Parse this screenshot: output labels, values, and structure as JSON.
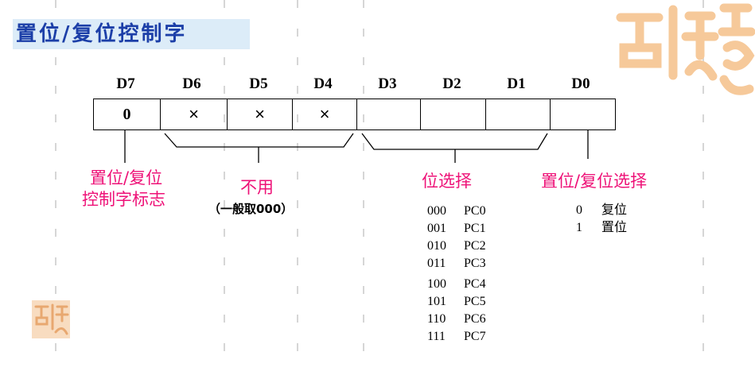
{
  "title": "置位/复位控制字",
  "bits": [
    {
      "label": "D7",
      "value": "0"
    },
    {
      "label": "D6",
      "value": "×"
    },
    {
      "label": "D5",
      "value": "×"
    },
    {
      "label": "D4",
      "value": "×"
    },
    {
      "label": "D3",
      "value": ""
    },
    {
      "label": "D2",
      "value": ""
    },
    {
      "label": "D1",
      "value": ""
    },
    {
      "label": "D0",
      "value": ""
    }
  ],
  "annotations": {
    "flag_line1": "置位/复位",
    "flag_line2": "控制字标志",
    "unused": "不用",
    "unused_note": "（一般取000）",
    "bit_select": "位选择",
    "set_reset_select": "置位/复位选择"
  },
  "bit_select_list": [
    {
      "code": "000",
      "port": "PC0"
    },
    {
      "code": "001",
      "port": "PC1"
    },
    {
      "code": "010",
      "port": "PC2"
    },
    {
      "code": "011",
      "port": "PC3"
    },
    {
      "code": "100",
      "port": "PC4"
    },
    {
      "code": "101",
      "port": "PC5"
    },
    {
      "code": "110",
      "port": "PC6"
    },
    {
      "code": "111",
      "port": "PC7"
    }
  ],
  "set_reset_list": [
    {
      "code": "0",
      "meaning": "复位"
    },
    {
      "code": "1",
      "meaning": "置位"
    }
  ],
  "colors": {
    "title": "#1c3fa8",
    "annotation": "#ee1177",
    "logo": "#f6c99a",
    "dashes": "#d6d6d6"
  }
}
